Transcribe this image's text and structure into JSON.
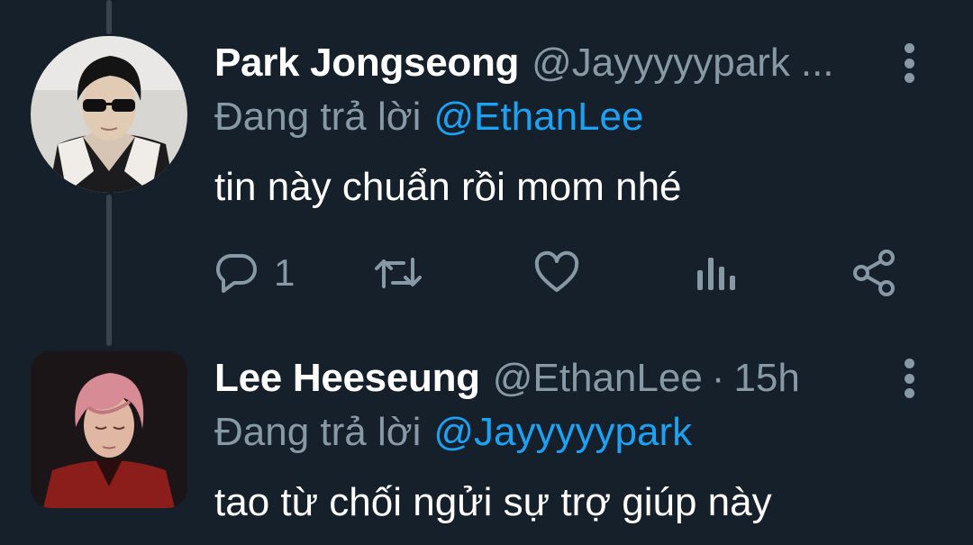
{
  "tweets": [
    {
      "display_name": "Park Jongseong",
      "handle": "@Jayyyyypark",
      "ellipsis": "...",
      "reply_prefix": "Đang trả lời",
      "reply_to": "@EthanLee",
      "text": "tin này chuẩn rồi mom nhé",
      "avatar": "round-profile-photo",
      "actions": {
        "reply_icon": "speech-bubble-icon",
        "reply_count": "1",
        "retweet_icon": "retweet-icon",
        "like_icon": "heart-icon",
        "analytics_icon": "bar-chart-icon",
        "share_icon": "share-icon"
      }
    },
    {
      "display_name": "Lee Heeseung",
      "handle": "@EthanLee",
      "separator": "·",
      "time": "15h",
      "reply_prefix": "Đang trả lời",
      "reply_to": "@Jayyyyypark",
      "text": "tao từ chối ngửi sự trợ giúp này",
      "avatar": "square-profile-photo"
    }
  ],
  "colors": {
    "background": "#15202b",
    "primary_text": "#ffffff",
    "secondary_text": "#8899a6",
    "link": "#1da1f2",
    "thread_line": "#38444d"
  }
}
